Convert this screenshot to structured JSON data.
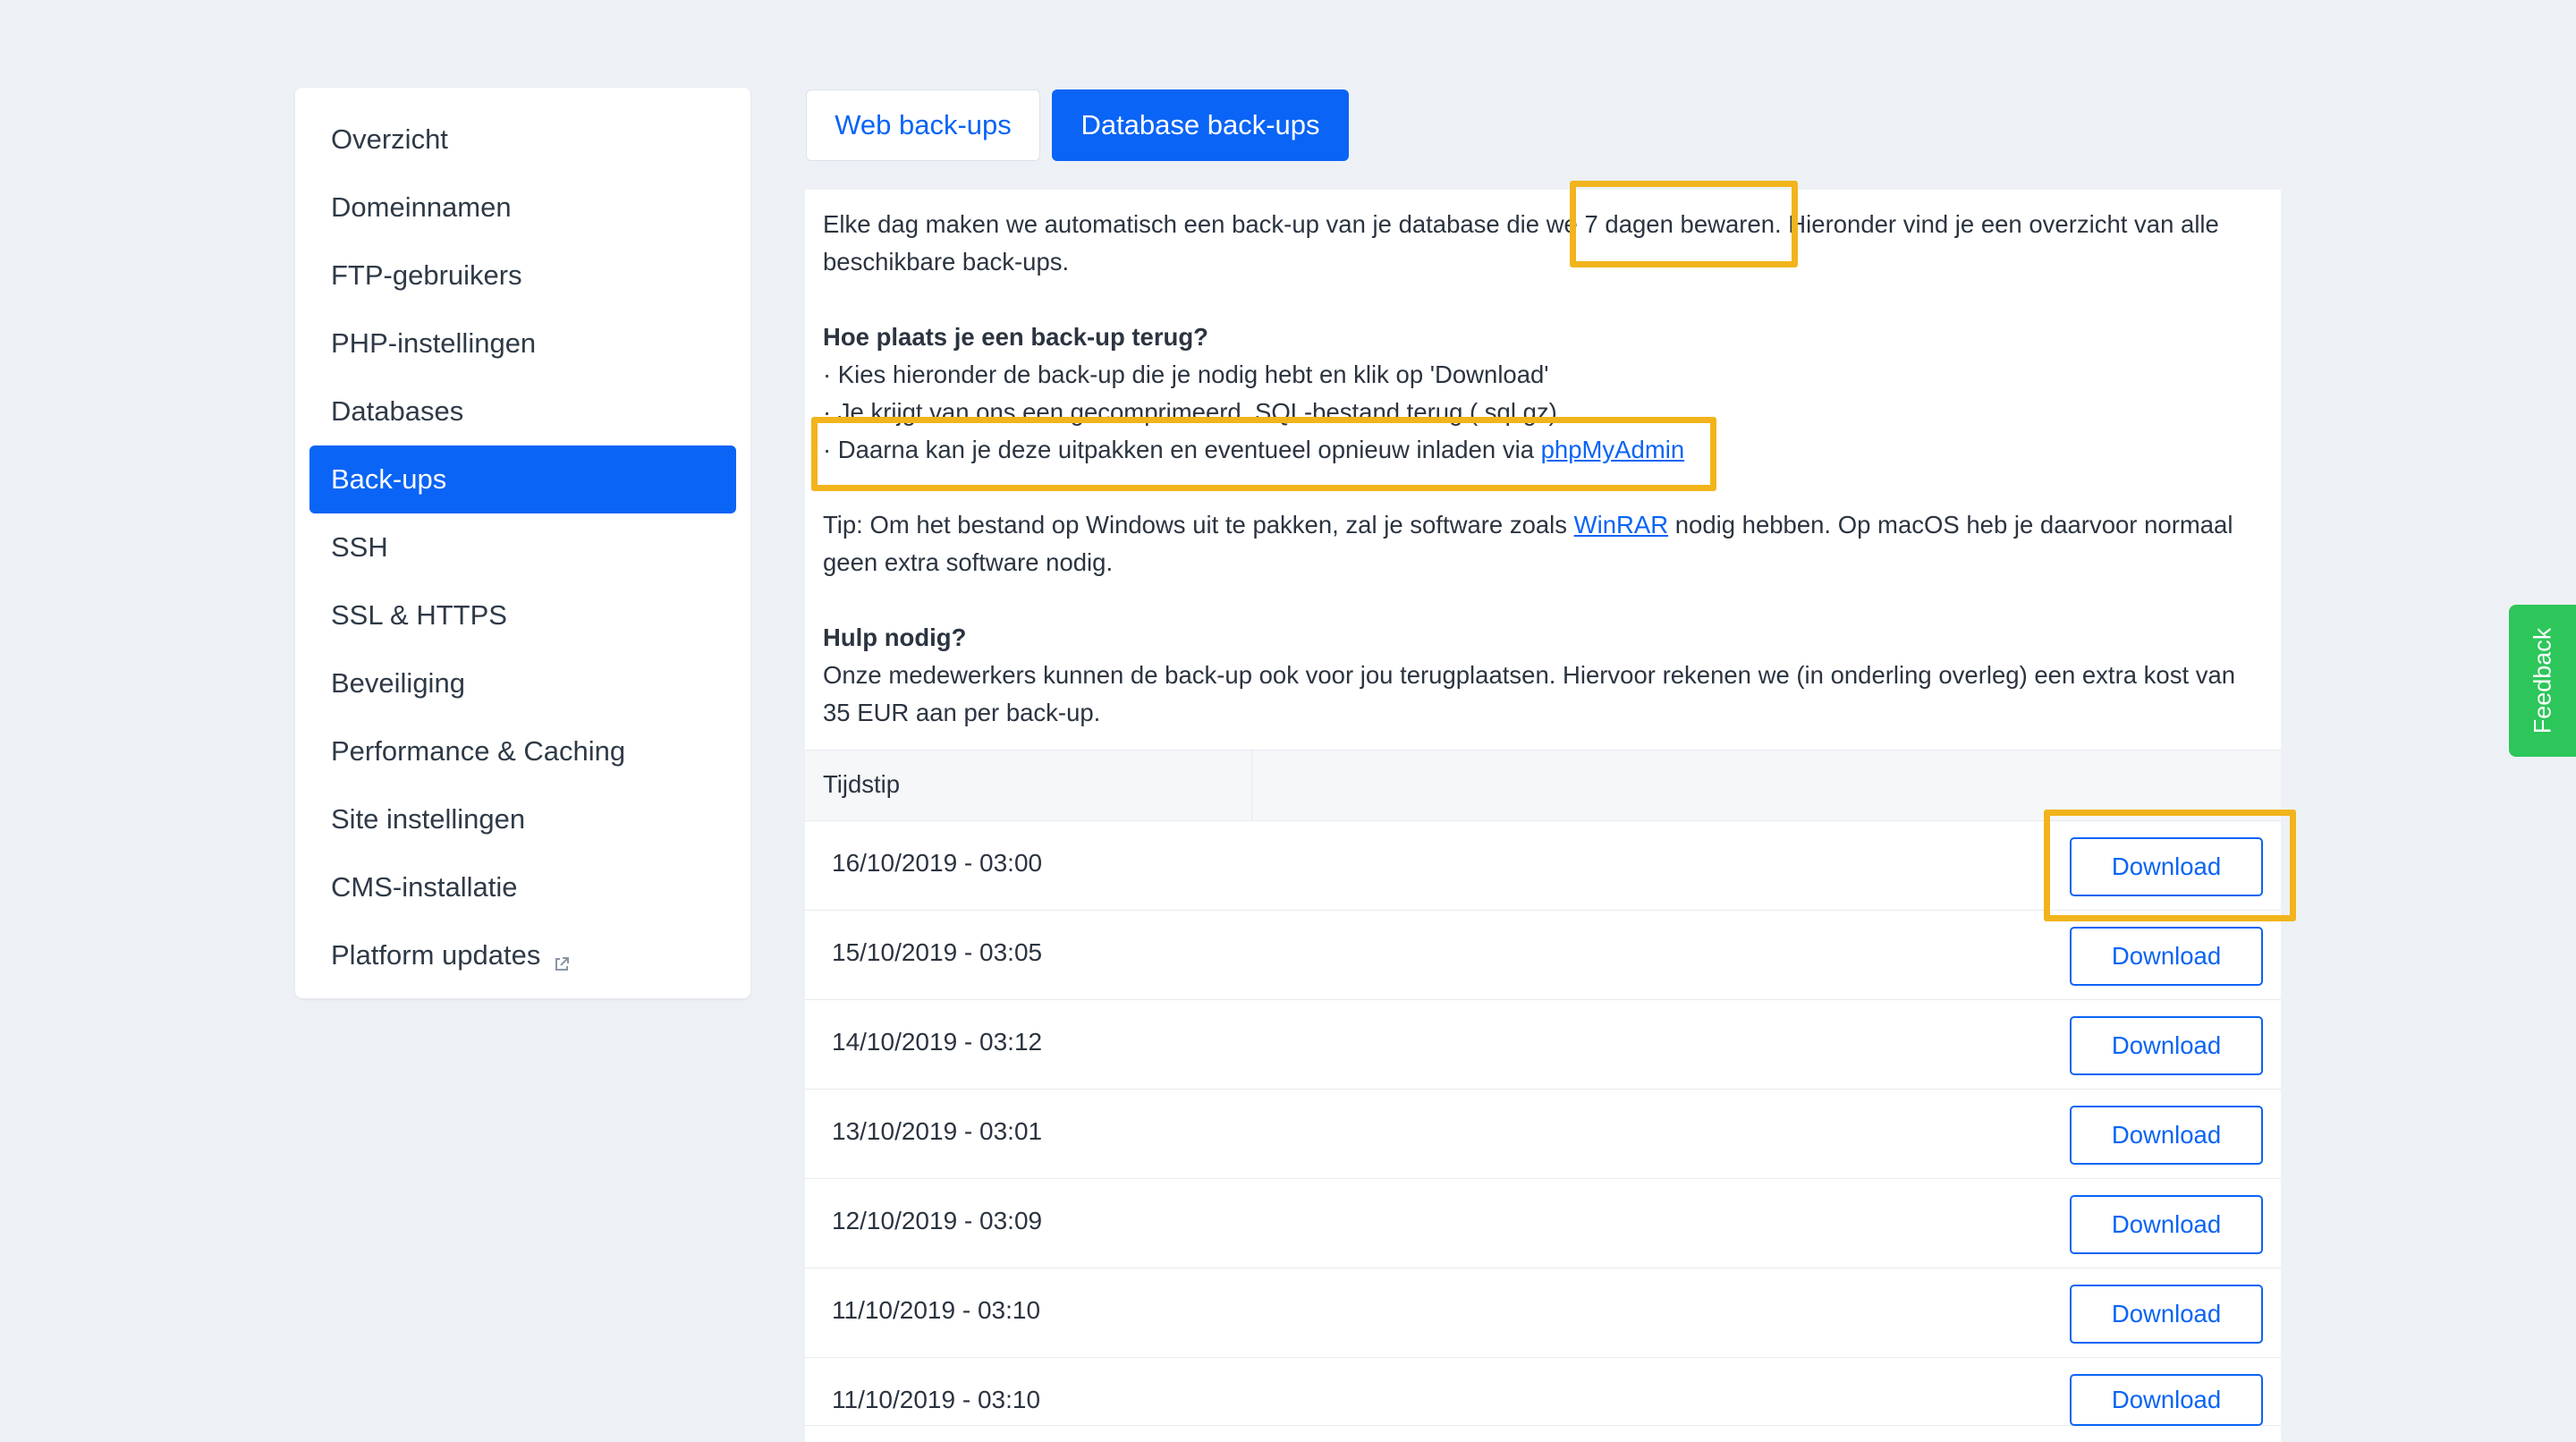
{
  "sidebar": {
    "items": [
      {
        "label": "Overzicht"
      },
      {
        "label": "Domeinnamen"
      },
      {
        "label": "FTP-gebruikers"
      },
      {
        "label": "PHP-instellingen"
      },
      {
        "label": "Databases"
      },
      {
        "label": "Back-ups",
        "active": true
      },
      {
        "label": "SSH"
      },
      {
        "label": "SSL & HTTPS"
      },
      {
        "label": "Beveiliging"
      },
      {
        "label": "Performance & Caching"
      },
      {
        "label": "Site instellingen"
      },
      {
        "label": "CMS-installatie"
      },
      {
        "label": "Platform updates",
        "icon": "external-link-icon"
      }
    ]
  },
  "tabs": {
    "web": "Web back-ups",
    "database": "Database back-ups",
    "active": "database"
  },
  "info": {
    "intro": "Elke dag maken we automatisch een back-up van je database die we 7 dagen bewaren. Hieronder vind je een overzicht van alle beschikbare back-ups.",
    "restore_heading": "Hoe plaats je een back-up terug?",
    "step1": "· Kies hieronder de back-up die je nodig hebt en klik op 'Download'",
    "step2": "· Je krijgt van ons een gecomprimeerd .SQL-bestand terug (.sql.gz)",
    "step3_prefix": "· Daarna kan je deze uitpakken en eventueel opnieuw inladen via ",
    "step3_link": "phpMyAdmin",
    "tip_prefix": "Tip: Om het bestand op Windows uit te pakken, zal je software zoals ",
    "tip_link": "WinRAR",
    "tip_suffix": " nodig hebben. Op macOS heb je daarvoor normaal geen extra software nodig.",
    "help_heading": "Hulp nodig?",
    "help_text": "Onze medewerkers kunnen de back-up ook voor jou terugplaatsen. Hiervoor rekenen we (in onderling overleg) een extra kost van 35 EUR aan per back-up."
  },
  "table": {
    "column_header": "Tijdstip",
    "download_label": "Download",
    "rows": [
      {
        "time": "16/10/2019 - 03:00"
      },
      {
        "time": "15/10/2019 - 03:05"
      },
      {
        "time": "14/10/2019 - 03:12"
      },
      {
        "time": "13/10/2019 - 03:01"
      },
      {
        "time": "12/10/2019 - 03:09"
      },
      {
        "time": "11/10/2019 - 03:10"
      },
      {
        "time": "11/10/2019 - 03:10"
      }
    ]
  },
  "feedback": {
    "label": "Feedback"
  },
  "colors": {
    "accent": "#0a64f5",
    "highlight": "#f2b41c",
    "feedback": "#2dc65a"
  }
}
